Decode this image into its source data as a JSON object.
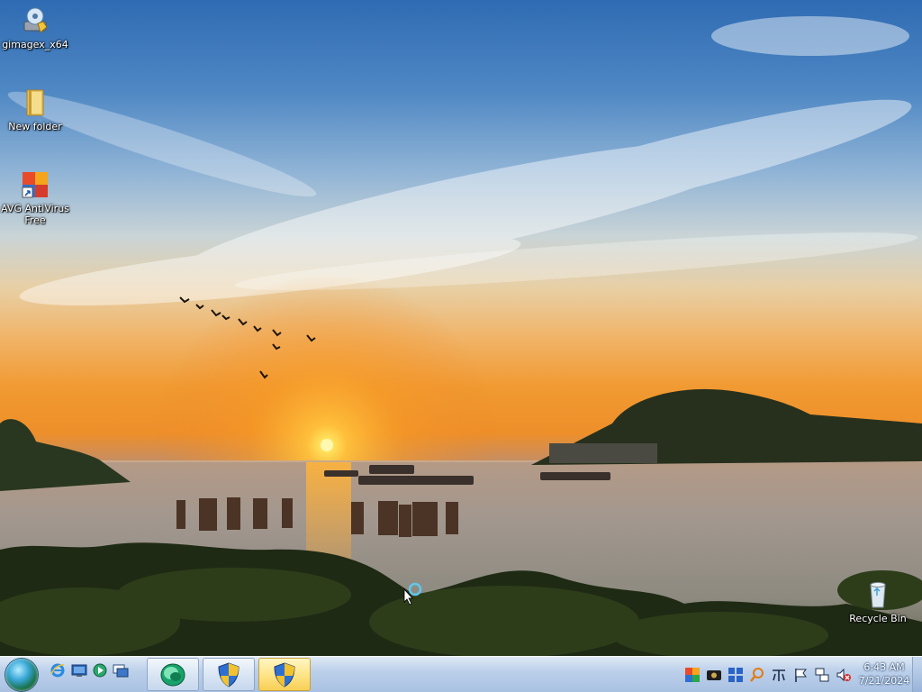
{
  "desktop": {
    "icons": [
      {
        "label": "gimagex_x64",
        "icon": "gimagex-drive-icon"
      },
      {
        "label": "New folder",
        "icon": "folder-icon"
      },
      {
        "label": "AVG AntiVirus Free",
        "icon": "avg-shortcut-icon"
      },
      {
        "label": "Recycle Bin",
        "icon": "recycle-bin-icon"
      }
    ]
  },
  "taskbar": {
    "start_button": "start-orb-icon",
    "quick_launch": [
      "internet-explorer-icon",
      "show-desktop-icon",
      "media-player-icon",
      "window-switch-icon"
    ],
    "tasks": [
      {
        "icon": "windows-media-center-icon",
        "active": false
      },
      {
        "icon": "uac-shield-icon",
        "active": false
      },
      {
        "icon": "uac-shield-icon",
        "active": true
      }
    ],
    "tray_icons": [
      "avg-tray-icon",
      "camera-tray-icon",
      "grid-tray-icon",
      "search-tray-icon",
      "language-tray-icon",
      "action-center-flag-icon",
      "network-icon",
      "volume-muted-icon"
    ],
    "clock": {
      "time": "6:43 AM",
      "date": "7/21/2024"
    }
  },
  "colors": {
    "taskbar_top": "#dfe9f5",
    "taskbar_bottom": "#a9c1e2",
    "sun": "#fff06a"
  }
}
